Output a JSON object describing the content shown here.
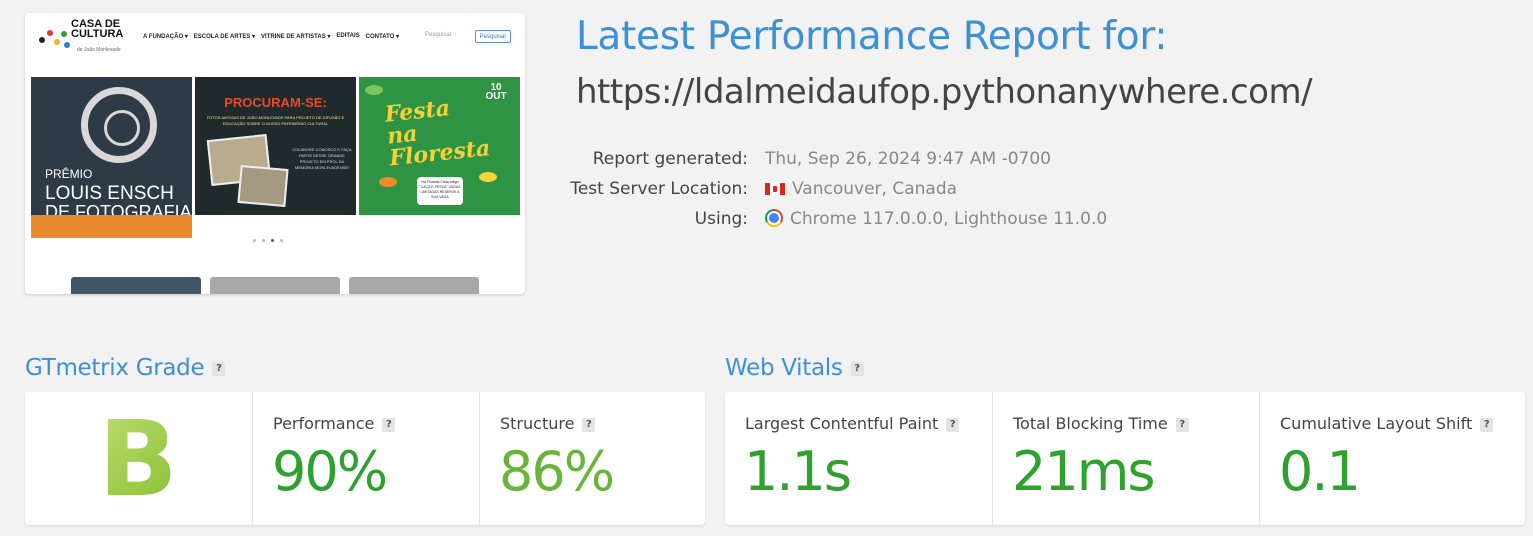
{
  "thumbnail": {
    "logo_text": "CASA DE CULTURA",
    "logo_sub": "de João Monlevade",
    "nav": [
      "A FUNDAÇÃO ▾",
      "ESCOLA DE ARTES ▾",
      "VITRINE DE ARTISTAS ▾",
      "EDITAIS",
      "CONTATO ▾"
    ],
    "search_placeholder": "Pesquisar",
    "search_button": "Pesquisar",
    "banner1_line1": "PRÊMIO",
    "banner1_line2": "LOUIS ENSCH",
    "banner1_line3": "DE FOTOGRAFIA",
    "banner2_title": "PROCURAM-SE:",
    "banner2_sub": "FOTOS ANTIGAS DE JOÃO MONLEVADE PARA PROJETO DE DIFUSÃO E EDUCAÇÃO SOBRE O NOSSO PATRIMÔNIO CULTURAL",
    "banner2_side": "COLABORE CONOSCO E FAÇA PARTE DESSE GRANDE PROJETO EM PROL DA MEMÓRIA MONLEVADENSE!",
    "banner3_title": "Festa na Floresta",
    "banner3_date": "10 OUT",
    "banner3_badge": "Na Floresta Cada artigo \"CAÇA E PESCA\" VAGAS LIMITADAS RESERVE A SUA VAGA",
    "pager_count": 4,
    "pager_active": 3
  },
  "report": {
    "title": "Latest Performance Report for:",
    "url": "https://ldalmeidaufop.pythonanywhere.com/",
    "meta": [
      {
        "label": "Report generated:",
        "value": "Thu, Sep 26, 2024 9:47 AM -0700",
        "icon": ""
      },
      {
        "label": "Test Server Location:",
        "value": "Vancouver, Canada",
        "icon": "canada-flag-icon"
      },
      {
        "label": "Using:",
        "value": "Chrome 117.0.0.0, Lighthouse 11.0.0",
        "icon": "chrome-icon"
      }
    ]
  },
  "grade": {
    "section_title": "GTmetrix Grade",
    "help": "?",
    "letter": "B",
    "performance_label": "Performance",
    "performance_value": "90%",
    "structure_label": "Structure",
    "structure_value": "86%"
  },
  "vitals": {
    "section_title": "Web Vitals",
    "help": "?",
    "lcp_label": "Largest Contentful Paint",
    "lcp_value": "1.1s",
    "tbt_label": "Total Blocking Time",
    "tbt_value": "21ms",
    "cls_label": "Cumulative Layout Shift",
    "cls_value": "0.1"
  },
  "colors": {
    "accent": "#3d8fd6",
    "good_green": "#2ea12e",
    "ok_green": "#6ab43a",
    "background": "#f2f2f2"
  }
}
